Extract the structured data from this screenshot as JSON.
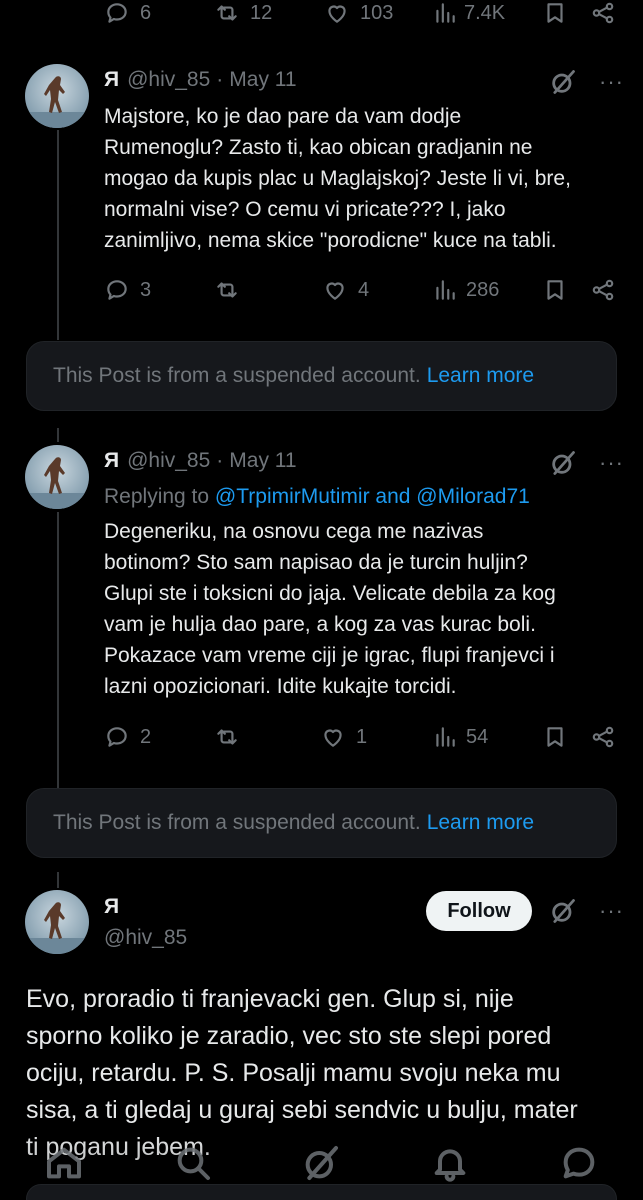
{
  "top_bar": {
    "replies": "6",
    "reposts": "12",
    "likes": "103",
    "views": "7.4K"
  },
  "posts": [
    {
      "name": "Я",
      "handle": "@hiv_85",
      "separator": "·",
      "date": "May 11",
      "more": "···",
      "text": "Majstore, ko je dao pare da vam dodje\nRumenoglu? Zasto ti, kao obican gradjanin ne\nmogao da kupis plac u Maglajskoj? Jeste li vi, bre,\nnormalni vise? O cemu vi pricate??? I, jako\nzanimljivo, nema skice \"porodicne\" kuce na tabli.",
      "replies": "3",
      "reposts": "",
      "likes": "4",
      "views": "286"
    },
    {
      "name": "Я",
      "handle": "@hiv_85",
      "separator": "·",
      "date": "May 11",
      "more": "···",
      "replying_prefix": "Replying to ",
      "replying_users": "@TrpimirMutimir and @Milorad71",
      "text": "Degeneriku, na osnovu cega me nazivas\nbotinom? Sto sam napisao da je turcin huljin?\nGlupi ste i toksicni do jaja. Velicate debila za kog\nvam je hulja dao pare, a kog za vas kurac boli.\nPokazace vam vreme ciji je igrac, flupi franjevci i\nlazni opozicionari. Idite kukajte torcidi.",
      "replies": "2",
      "reposts": "",
      "likes": "1",
      "views": "54"
    }
  ],
  "suspended_notices": [
    {
      "text": "This Post is from a suspended account.",
      "link": "Learn more"
    },
    {
      "text": "This Post is from a suspended account.",
      "link": "Learn more"
    }
  ],
  "main_post": {
    "name": "Я",
    "handle": "@hiv_85",
    "follow_label": "Follow",
    "more": "···",
    "text": "Evo, proradio ti franjevacki gen. Glup si, nije\nsporno koliko je zaradio, vec sto ste slepi pored\nociju, retardu. P. S. Posalji mamu svoju neka mu\nsisa, a ti gledaj u guraj sebi sendvic u bulju, mater\nti poganu jebem."
  },
  "colors": {
    "background": "#000000",
    "text": "#e7e9ea",
    "muted": "#71767b",
    "accent": "#1d9bf0",
    "card": "#16181c"
  },
  "icons": [
    "reply-icon",
    "repost-icon",
    "like-icon",
    "views-icon",
    "bookmark-icon",
    "share-icon",
    "grok-icon",
    "home-icon",
    "search-icon",
    "notifications-icon",
    "messages-icon"
  ]
}
